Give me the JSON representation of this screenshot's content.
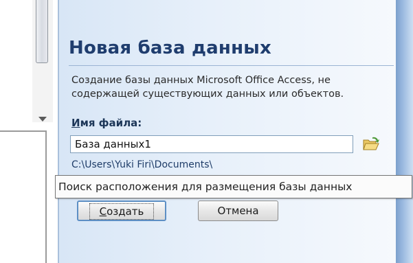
{
  "dialog": {
    "title": "Новая база данных",
    "description": "Создание базы данных Microsoft Office Access, не содержащей существующих данных или объектов.",
    "filename_label_accel": "И",
    "filename_label_rest": "мя файла:",
    "filename_value": "База данных1",
    "path": "C:\\Users\\Yuki Firi\\Documents\\",
    "tooltip": "Поиск расположения для размещения базы данных",
    "create_label_accel": "С",
    "create_label_rest": "оздать",
    "cancel_label": "Отмена"
  },
  "icons": {
    "browse": "open-folder-icon",
    "scroll_down": "scroll-down-arrow-icon"
  },
  "colors": {
    "title": "#1f3d6e",
    "panel_bg": "#e7f0fa",
    "panel_edge": "#7ca0cc",
    "button_focus": "#5d8fc4"
  }
}
